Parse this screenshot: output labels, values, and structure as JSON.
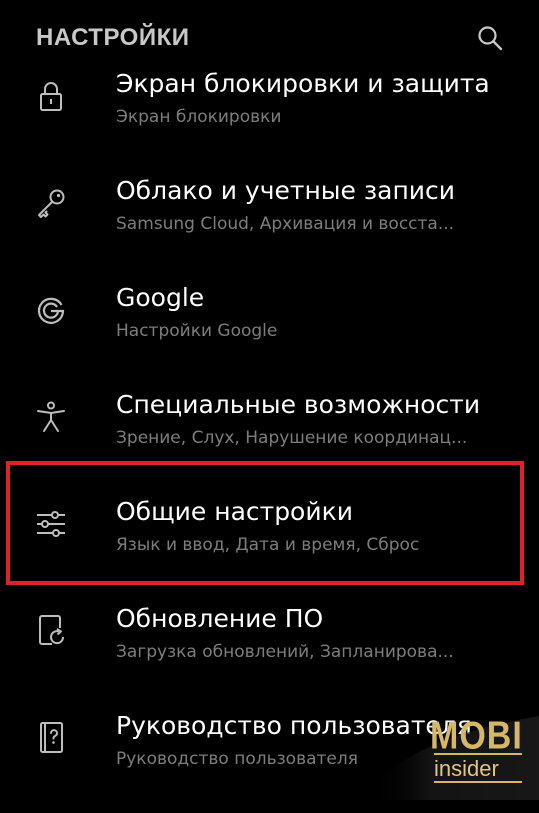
{
  "header": {
    "title": "НАСТРОЙКИ",
    "search_icon": "search-icon"
  },
  "settings_items": [
    {
      "icon": "lock-icon",
      "title": "Экран блокировки и защита",
      "subtitle": "Экран блокировки"
    },
    {
      "icon": "key-icon",
      "title": "Облако и учетные записи",
      "subtitle": "Samsung Cloud, Архивация и восста..."
    },
    {
      "icon": "google-icon",
      "title": "Google",
      "subtitle": "Настройки Google"
    },
    {
      "icon": "accessibility-icon",
      "title": "Специальные возможности",
      "subtitle": "Зрение, Слух, Нарушение координац..."
    },
    {
      "icon": "sliders-icon",
      "title": "Общие настройки",
      "subtitle": "Язык и ввод, Дата и время, Сброс"
    },
    {
      "icon": "software-update-icon",
      "title": "Обновление ПО",
      "subtitle": "Загрузка обновлений, Запланирова..."
    },
    {
      "icon": "user-manual-icon",
      "title": "Руководство пользователя",
      "subtitle": "Руководство пользователя"
    }
  ],
  "highlight": {
    "item_index": 4,
    "color": "#e0202a"
  },
  "watermark": {
    "line1": "MOBI",
    "line2": "insider",
    "color": "#d6b766"
  },
  "colors": {
    "background": "#000000",
    "title": "#ffffff",
    "subtitle": "#7d7d7d",
    "header": "#c8c8c8"
  }
}
